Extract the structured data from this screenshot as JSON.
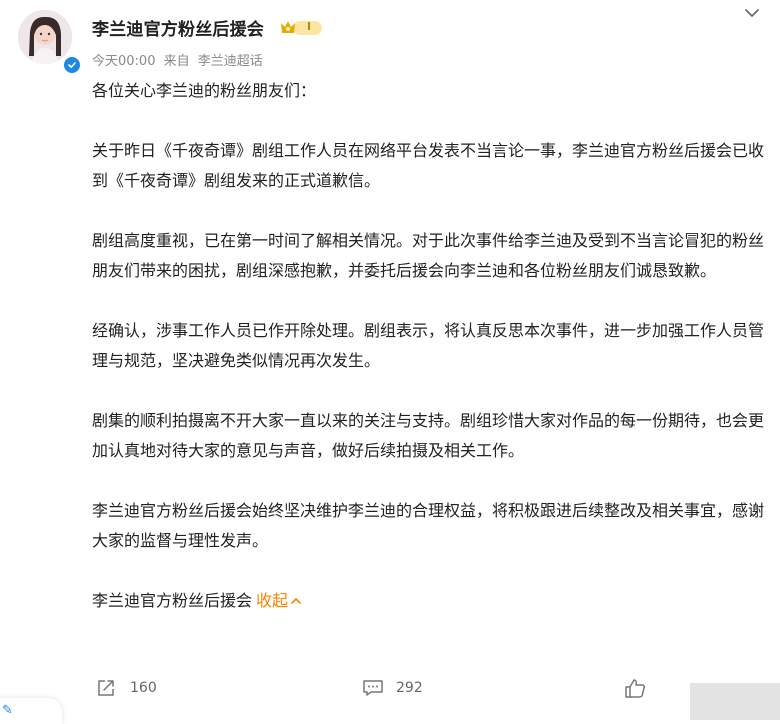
{
  "header": {
    "author": "李兰迪官方粉丝后援会",
    "badge_level": "I",
    "time": "今天00:00",
    "from_label": "来自",
    "source": "李兰迪超话"
  },
  "post": {
    "greeting": "各位关心李兰迪的粉丝朋友们：",
    "paragraphs": [
      "关于昨日《千夜奇谭》剧组工作人员在网络平台发表不当言论一事，李兰迪官方粉丝后援会已收到《千夜奇谭》剧组发来的正式道歉信。",
      "剧组高度重视，已在第一时间了解相关情况。对于此次事件给李兰迪及受到不当言论冒犯的粉丝朋友们带来的困扰，剧组深感抱歉，并委托后援会向李兰迪和各位粉丝朋友们诚恳致歉。",
      "经确认，涉事工作人员已作开除处理。剧组表示，将认真反思本次事件，进一步加强工作人员管理与规范，坚决避免类似情况再次发生。",
      "剧集的顺利拍摄离不开大家一直以来的关注与支持。剧组珍惜大家对作品的每一份期待，也会更加认真地对待大家的意见与声音，做好后续拍摄及相关工作。",
      "李兰迪官方粉丝后援会始终坚决维护李兰迪的合理权益，将积极跟进后续整改及相关事宜，感谢大家的监督与理性发声。"
    ],
    "signature": "李兰迪官方粉丝后援会",
    "collapse_label": "收起"
  },
  "toolbar": {
    "repost_count": "160",
    "comment_count": "292"
  },
  "colors": {
    "accent": "#ff8200",
    "verify": "#1e88e5",
    "muted": "#8a8a8a"
  },
  "icons": [
    "chevron-down-icon",
    "verified-icon",
    "fan-badge-icon",
    "repost-icon",
    "comment-icon",
    "like-icon"
  ]
}
